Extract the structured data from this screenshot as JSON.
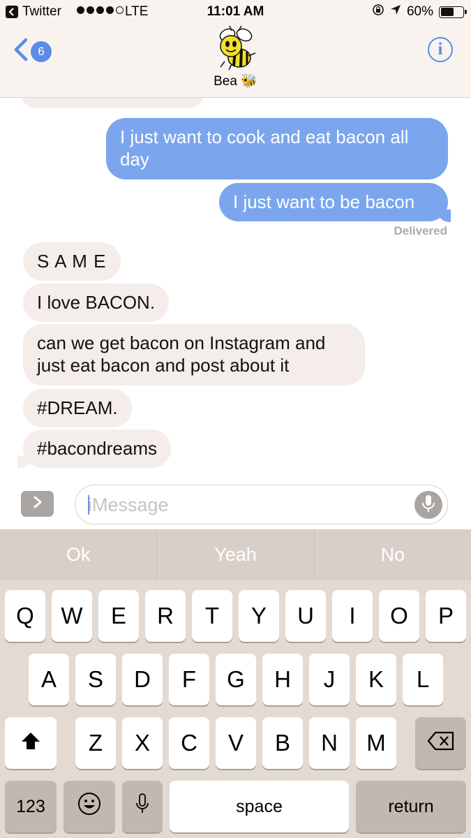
{
  "status_bar": {
    "back_app": "Twitter",
    "carrier": "LTE",
    "time": "11:01 AM",
    "battery": "60%",
    "battery_level": 0.6
  },
  "header": {
    "back_badge": "6",
    "contact_name": "Bea 🐝",
    "info_label": "i"
  },
  "messages": [
    {
      "direction": "out",
      "text": "I just want to cook and eat bacon all day"
    },
    {
      "direction": "out",
      "text": "I just want to be bacon"
    },
    {
      "direction": "in",
      "text": "S A M E"
    },
    {
      "direction": "in",
      "text": "I love BACON."
    },
    {
      "direction": "in",
      "text": "can we get bacon on Instagram and just eat bacon and post about it"
    },
    {
      "direction": "in",
      "text": "#DREAM."
    },
    {
      "direction": "in",
      "text": "#bacondreams"
    }
  ],
  "delivered_label": "Delivered",
  "composer": {
    "placeholder": "iMessage",
    "value": ""
  },
  "predictions": [
    "Ok",
    "Yeah",
    "No"
  ],
  "keyboard": {
    "row1": [
      "Q",
      "W",
      "E",
      "R",
      "T",
      "Y",
      "U",
      "I",
      "O",
      "P"
    ],
    "row2": [
      "A",
      "S",
      "D",
      "F",
      "G",
      "H",
      "J",
      "K",
      "L"
    ],
    "row3": [
      "Z",
      "X",
      "C",
      "V",
      "B",
      "N",
      "M"
    ],
    "numbers_label": "123",
    "space_label": "space",
    "return_label": "return"
  },
  "colors": {
    "outgoing_bubble": "#7ba6ee",
    "incoming_bubble": "#f4ede9",
    "accent": "#5a8ce6"
  }
}
